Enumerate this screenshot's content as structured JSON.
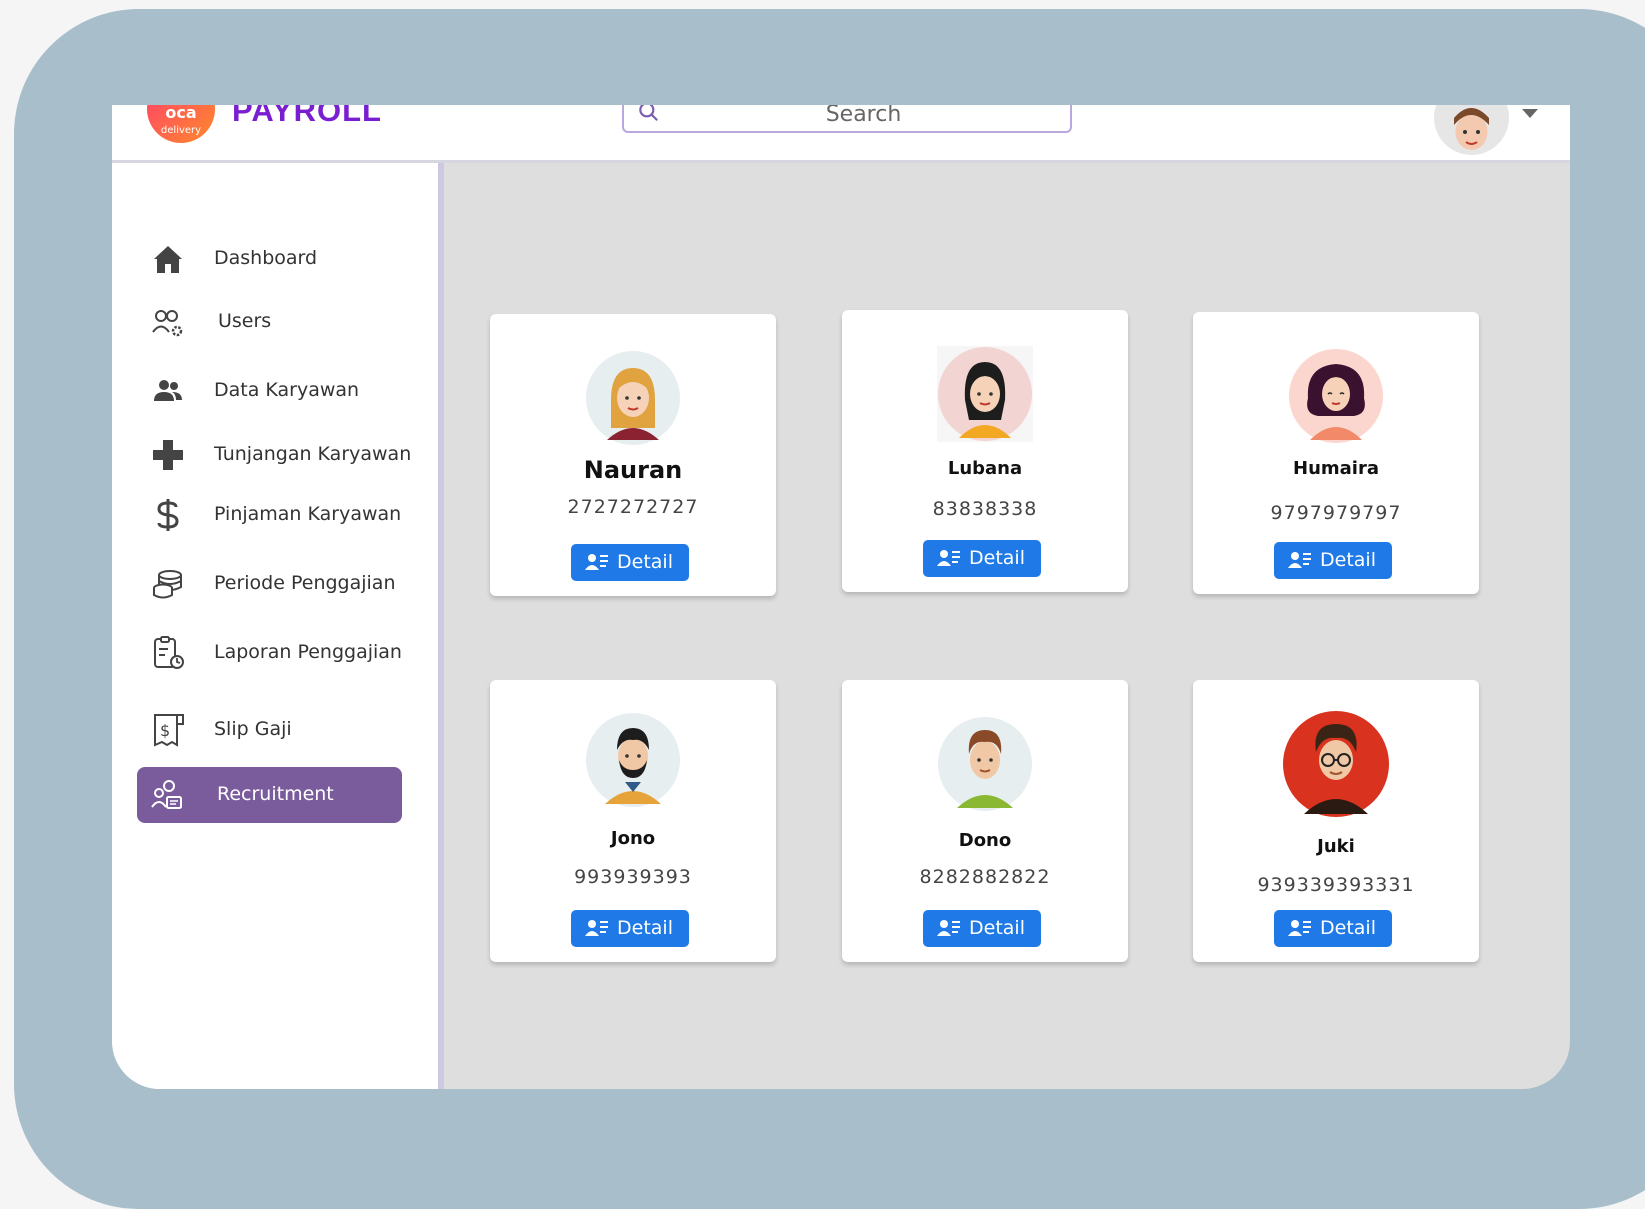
{
  "header": {
    "logo_line1": "oca",
    "logo_line2": "delivery",
    "brand": "PAYROLL",
    "search_placeholder": "Search"
  },
  "sidebar": {
    "items": [
      {
        "label": "Dashboard",
        "icon": "home-icon"
      },
      {
        "label": "Users",
        "icon": "users-settings-icon"
      },
      {
        "label": "Data Karyawan",
        "icon": "people-icon"
      },
      {
        "label": "Tunjangan Karyawan",
        "icon": "plus-icon"
      },
      {
        "label": "Pinjaman Karyawan",
        "icon": "dollar-icon"
      },
      {
        "label": "Periode Penggajian",
        "icon": "coins-stack-icon"
      },
      {
        "label": "Laporan Penggajian",
        "icon": "report-clock-icon"
      },
      {
        "label": "Slip Gaji",
        "icon": "receipt-icon"
      },
      {
        "label": "Recruitment",
        "icon": "recruitment-icon"
      }
    ],
    "active": "Recruitment"
  },
  "cards": [
    {
      "name": "Nauran",
      "number": "2727272727",
      "button": "Detail"
    },
    {
      "name": "Lubana",
      "number": "83838338",
      "button": "Detail"
    },
    {
      "name": "Humaira",
      "number": "9797979797",
      "button": "Detail"
    },
    {
      "name": "Jono",
      "number": "993939393",
      "button": "Detail"
    },
    {
      "name": "Dono",
      "number": "8282882822",
      "button": "Detail"
    },
    {
      "name": "Juki",
      "number": "939339393331",
      "button": "Detail"
    }
  ],
  "colors": {
    "frame": "#a8bfcb",
    "brand": "#7a1fd0",
    "active_nav": "#7a5c9c",
    "button": "#1f7ae8",
    "content_bg": "#dedede"
  }
}
